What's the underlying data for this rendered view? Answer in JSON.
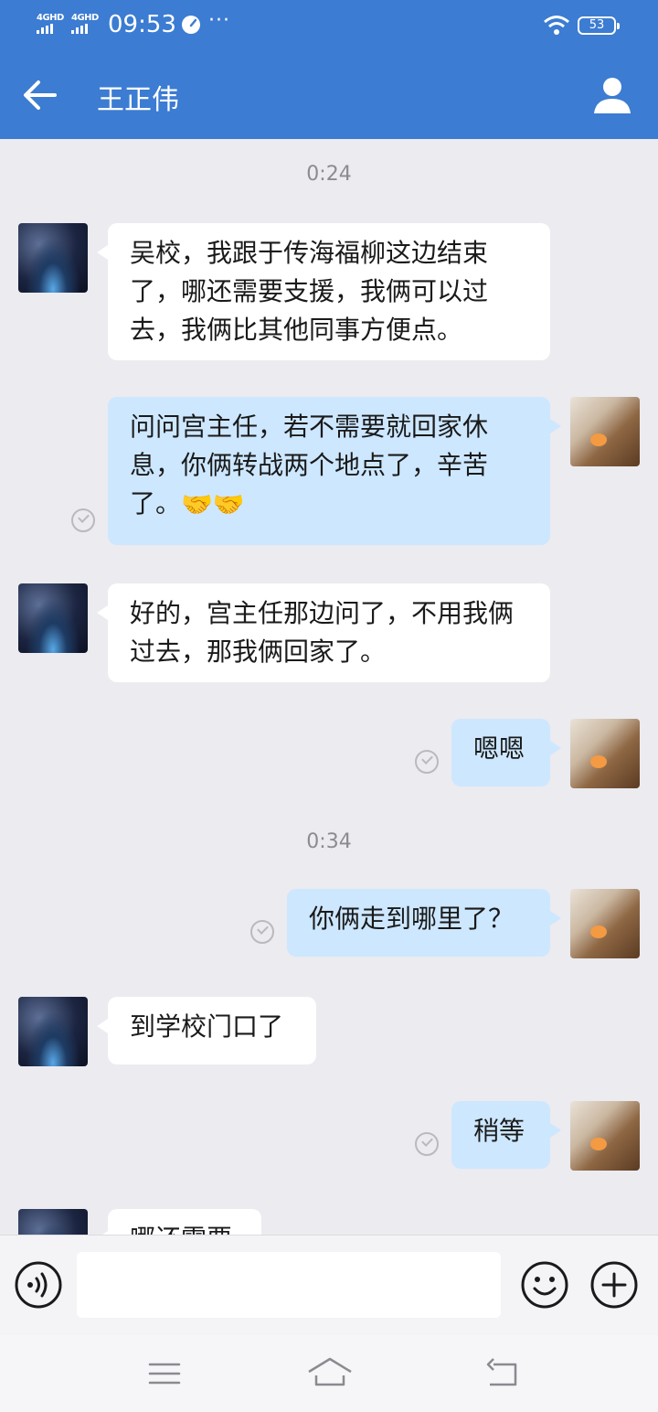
{
  "status_bar": {
    "network_1": "4GHD",
    "network_2": "4GHD",
    "time": "09:53",
    "more": "···",
    "battery": "53",
    "icons": [
      "signal-icon",
      "speedometer-icon",
      "wifi-icon",
      "battery-icon"
    ]
  },
  "header": {
    "title": "王正伟",
    "back_icon": "arrow-left-icon",
    "profile_icon": "person-icon"
  },
  "messages": [
    {
      "type": "time",
      "text": "0:24"
    },
    {
      "type": "in",
      "text": "吴校，我跟于传海福柳这边结束了，哪还需要支援，我俩可以过去，我俩比其他同事方便点。"
    },
    {
      "type": "out",
      "text": "问问宫主任，若不需要就回家休息，你俩转战两个地点了，辛苦了。",
      "emoji": "🤝🤝",
      "status": "read-check-icon"
    },
    {
      "type": "in",
      "text": "好的，宫主任那边问了，不用我俩过去，那我俩回家了。"
    },
    {
      "type": "out",
      "text": "嗯嗯",
      "status": "read-check-icon"
    },
    {
      "type": "time",
      "text": "0:34"
    },
    {
      "type": "out",
      "text": "你俩走到哪里了？",
      "status": "read-check-icon"
    },
    {
      "type": "in",
      "text": "到学校门口了"
    },
    {
      "type": "out",
      "text": "稍等",
      "status": "read-check-icon"
    },
    {
      "type": "in",
      "text": "哪还需要"
    }
  ],
  "input_bar": {
    "placeholder": "",
    "icons": [
      "voice-icon",
      "emoji-icon",
      "plus-icon"
    ]
  },
  "nav_bar": {
    "icons": [
      "menu-icon",
      "home-icon",
      "back-icon"
    ]
  }
}
